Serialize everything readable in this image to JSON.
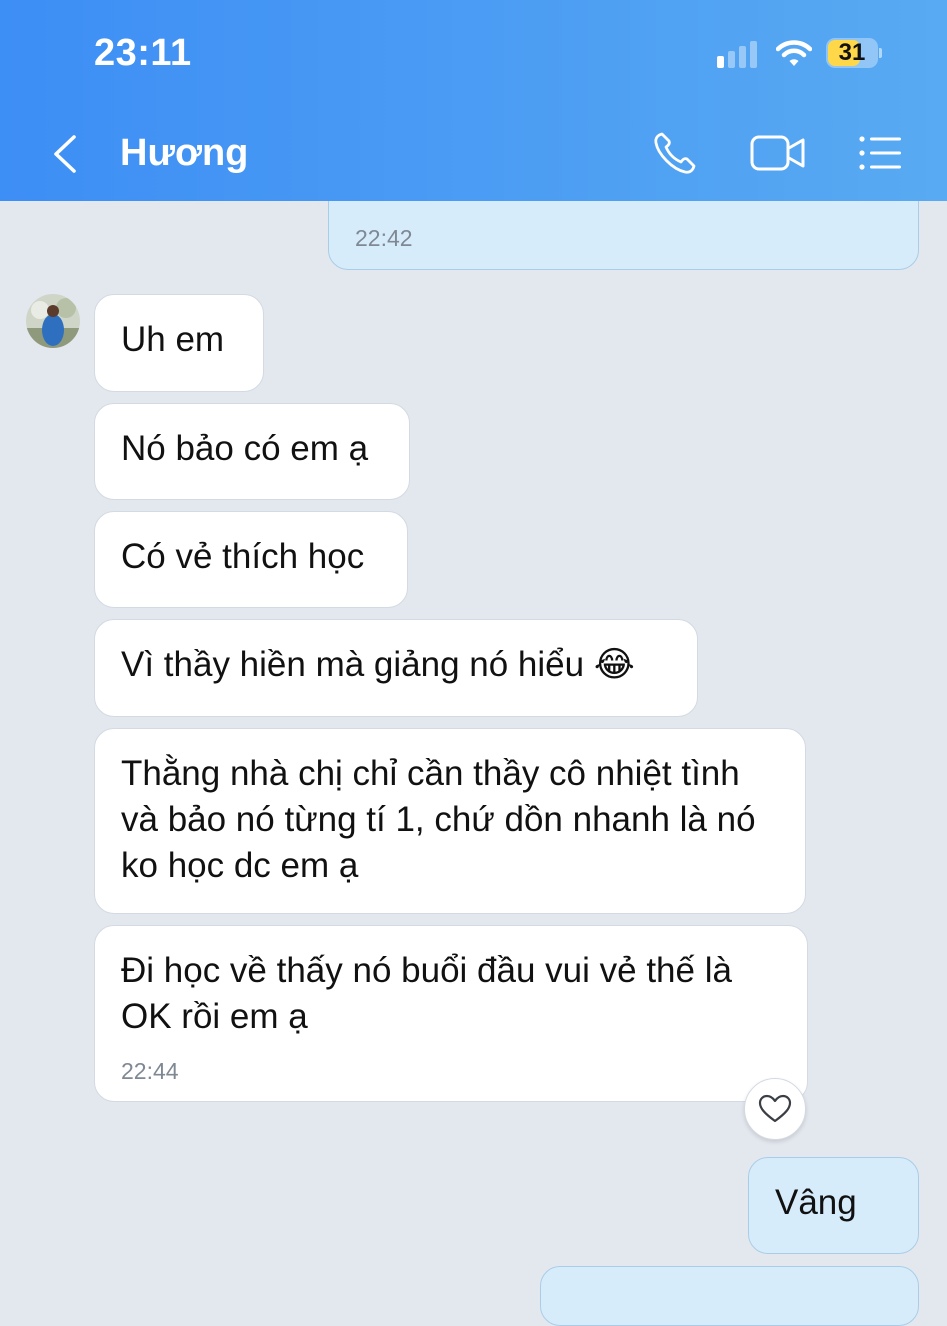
{
  "status_bar": {
    "time": "23:11",
    "battery": "31"
  },
  "header": {
    "contact_name": "Hương"
  },
  "messages": [
    {
      "sender": "me",
      "text": "",
      "time": "22:42"
    },
    {
      "sender": "contact",
      "text": "Uh em"
    },
    {
      "sender": "contact",
      "text": "Nó bảo có em ạ"
    },
    {
      "sender": "contact",
      "text": "Có vẻ thích học"
    },
    {
      "sender": "contact",
      "text": "Vì thầy hiền mà giảng nó hiểu 😂"
    },
    {
      "sender": "contact",
      "text": "Thằng nhà chị chỉ cần thầy cô nhiệt tình và bảo nó từng tí 1, chứ dồn nhanh là nó ko học dc em ạ"
    },
    {
      "sender": "contact",
      "text": "Đi học về thấy nó buổi đầu vui vẻ thế là OK rồi em ạ",
      "time": "22:44"
    },
    {
      "sender": "me",
      "text": "Vâng"
    }
  ],
  "icons": {
    "back": "chevron-left-icon",
    "call": "phone-icon",
    "video": "video-camera-icon",
    "menu": "list-menu-icon",
    "react": "heart-icon"
  },
  "colors": {
    "header_start": "#3d8ef5",
    "header_end": "#58aaf2",
    "chat_background": "#e3e7ee",
    "my_bubble": "#d7ecfb",
    "their_bubble": "#ffffff",
    "battery": "#ffd84a"
  }
}
